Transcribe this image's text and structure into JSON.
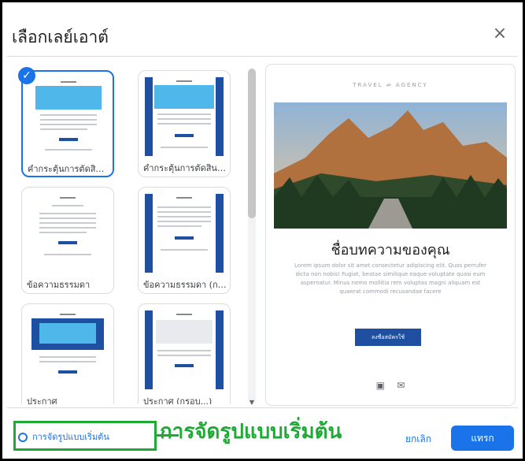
{
  "dialog": {
    "title": "เลือกเลย์เอาต์",
    "close_label": "×"
  },
  "layouts": [
    {
      "label": "คำกระตุ้นการตัดสินใจ",
      "selected": true
    },
    {
      "label": "คำกระตุ้นการตัดสินใ...",
      "selected": false
    },
    {
      "label": "ข้อความธรรมดา",
      "selected": false
    },
    {
      "label": "ข้อความธรรมดา (กล์...",
      "selected": false
    },
    {
      "label": "ประกาศ",
      "selected": false
    },
    {
      "label": "ประกาศ (กรอบ...)",
      "selected": false
    }
  ],
  "preview": {
    "agency": "TRAVEL ⇌ AGENCY",
    "heading": "ชื่อบทความของคุณ",
    "body": "Lorem ipsum dolor sit amet consectetur adipiscing elit. Quos perrufer dicta non nobis! Fugiat, beatae similique eaque voluptate quasi eum aspernatur. Minus nemo mollitia rem voluptas magni aliquam est quaerat commodi recusandae facere",
    "button": "ลงชื่อสมัครใช้"
  },
  "footer": {
    "reset": "การจัดรูปแบบเริ่มต้น",
    "callout": "การจัดรูปแบบเริ่มต้น",
    "cancel": "ยกเลิก",
    "insert": "แทรก"
  },
  "colors": {
    "accent": "#1a73e8",
    "template_blue": "#1e4fa0",
    "hero_blue": "#4fb7ea",
    "annotation_green": "#1faa36"
  }
}
